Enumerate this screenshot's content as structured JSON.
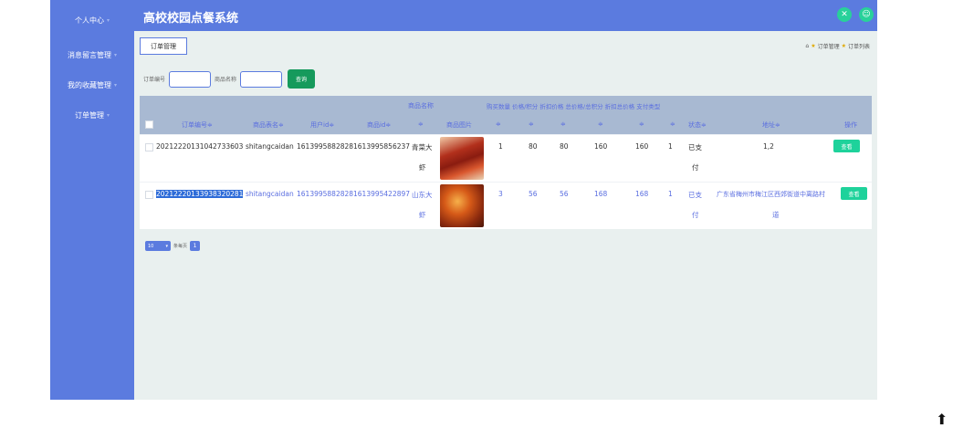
{
  "app": {
    "title": "高校校园点餐系统"
  },
  "sidebar": {
    "items": [
      {
        "label": "个人中心"
      },
      {
        "label": "消息留言管理"
      },
      {
        "label": "我的收藏管理"
      },
      {
        "label": "订单管理"
      }
    ]
  },
  "header": {
    "icon_left": "✕",
    "icon_right": "☺"
  },
  "tab": {
    "label": "订单管理"
  },
  "breadcrumb": {
    "home": "⌂",
    "star": "★",
    "level1": "订单管理",
    "level2": "订单列表"
  },
  "search": {
    "order_label": "订单编号",
    "order_value": "",
    "product_label": "商品名称",
    "product_value": "",
    "button": "查询"
  },
  "table": {
    "headers": {
      "product_name": "商品名称",
      "group2": "购买数量 价格/积分 折扣价格 总价格/总积分 折扣总价格 支付类型",
      "order_no": "订单编号≑",
      "table_name": "商品表名≑",
      "user_id": "用户id≑",
      "goods_id": "商品id≑",
      "name_sort": "≑",
      "image": "商品图片",
      "s1": "≑",
      "s2": "≑",
      "s3": "≑",
      "s4": "≑",
      "s5": "≑",
      "s6": "≑",
      "status": "状态≑",
      "address": "地址≑",
      "action": "操作"
    },
    "rows": [
      {
        "order_no": "20212220131042733603",
        "table_name": "shitangcaidan",
        "user_id": "1613995882828",
        "goods_id": "1613995856237",
        "name_l1": "青菜大",
        "name_l2": "虾",
        "qty": "1",
        "price": "80",
        "discount_price": "80",
        "total": "160",
        "discount_total": "160",
        "pay_type": "1",
        "status_l1": "已支",
        "status_l2": "付",
        "address_l1": "1,2",
        "address_l2": "",
        "action": "查看"
      },
      {
        "order_no": "20212220133938320281",
        "table_name": "shitangcaidan",
        "user_id": "1613995882828",
        "goods_id": "1613995422897",
        "name_l1": "山东大",
        "name_l2": "虾",
        "qty": "3",
        "price": "56",
        "discount_price": "56",
        "total": "168",
        "discount_total": "168",
        "pay_type": "1",
        "status_l1": "已支",
        "status_l2": "付",
        "address_l1": "广东省梅州市梅江区西郊街道中离路村",
        "address_l2": "道",
        "action": "查看"
      }
    ]
  },
  "pager": {
    "size": "10",
    "per_page_label": "条每页",
    "current_page": "1"
  },
  "to_top": "⬆"
}
